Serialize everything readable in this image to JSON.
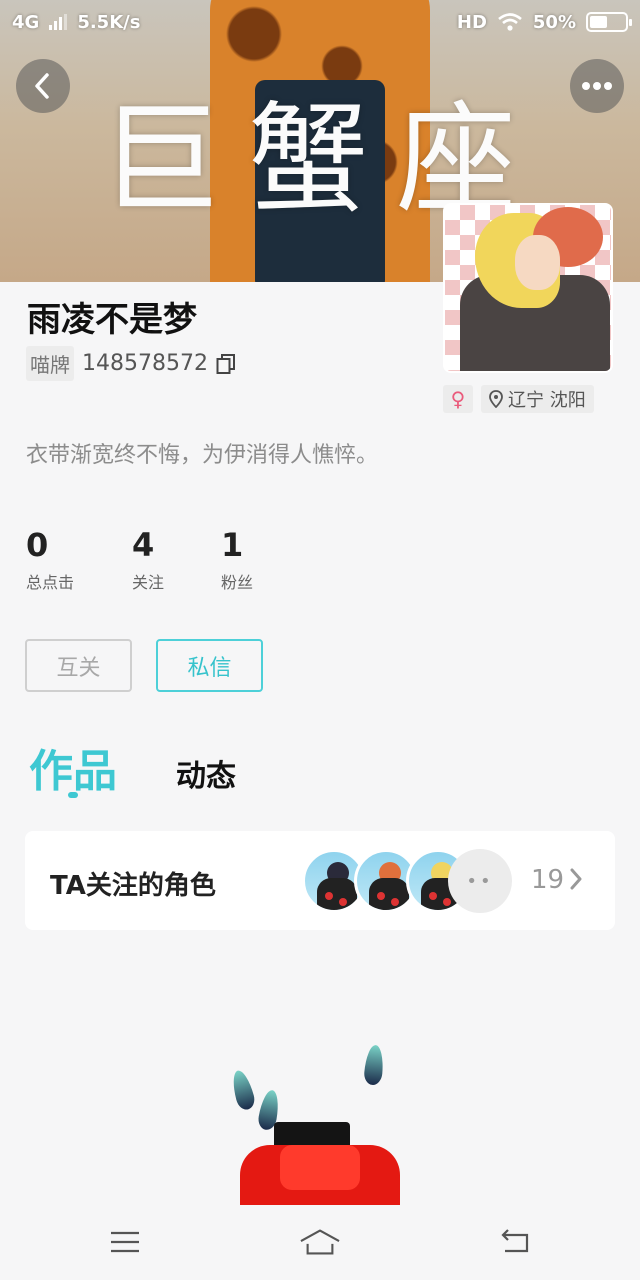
{
  "status_bar": {
    "network": "4G",
    "speed": "5.5K/s",
    "hd": "HD",
    "battery_percent": "50%",
    "battery_level": 0.5,
    "signal_icon": "cell-signal-icon",
    "wifi_icon": "wifi-icon"
  },
  "banner": {
    "text": "巨蟹座",
    "back_icon": "chevron-left-icon",
    "more_icon": "more-dots-icon"
  },
  "profile": {
    "nickname": "雨凌不是梦",
    "id_label": "喵牌",
    "id_number": "148578572",
    "copy_icon": "copy-icon",
    "gender_symbol": "♀",
    "location": "辽宁 沈阳",
    "signature": "衣带渐宽终不悔，为伊消得人憔悴。"
  },
  "stats": [
    {
      "value": "0",
      "label": "总点击"
    },
    {
      "value": "4",
      "label": "关注"
    },
    {
      "value": "1",
      "label": "粉丝"
    }
  ],
  "buttons": {
    "mutual": "互关",
    "message": "私信"
  },
  "tabs": {
    "works": "作品",
    "moments": "动态"
  },
  "card": {
    "title": "TA关注的角色",
    "count": "19",
    "more_dots": "••"
  },
  "colors": {
    "accent": "#3ec8d2",
    "gender": "#ea5b7c"
  }
}
